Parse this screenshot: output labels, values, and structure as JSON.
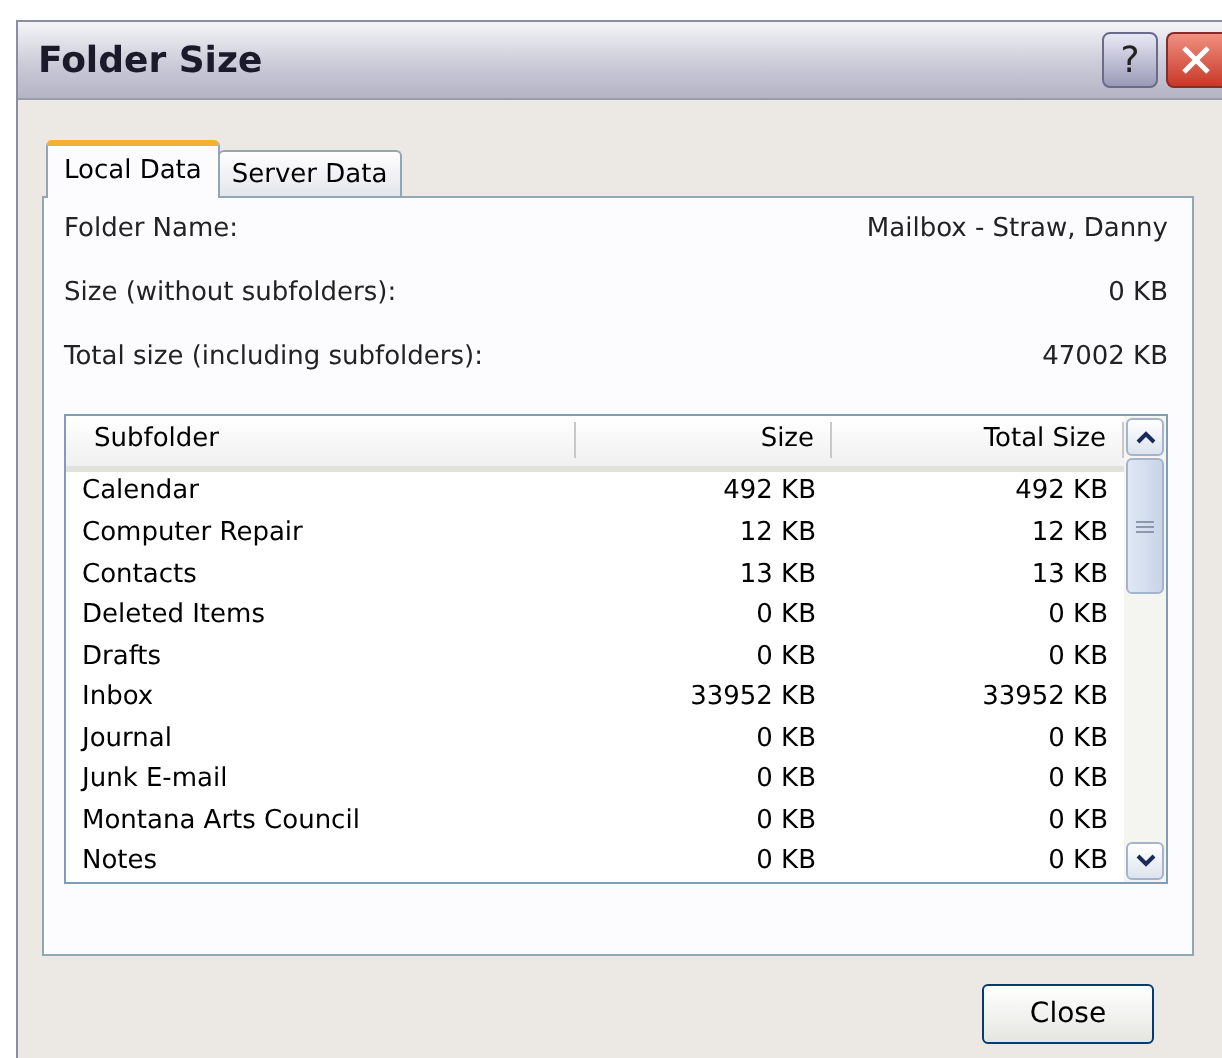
{
  "window": {
    "title": "Folder Size",
    "help_button": "?"
  },
  "tabs": [
    {
      "label": "Local Data",
      "selected": true
    },
    {
      "label": "Server Data",
      "selected": false
    }
  ],
  "info": [
    {
      "label": "Folder Name:",
      "value": "Mailbox - Straw, Danny"
    },
    {
      "label": "Size (without subfolders):",
      "value": "0 KB"
    },
    {
      "label": "Total size (including subfolders):",
      "value": "47002 KB"
    }
  ],
  "table": {
    "columns": [
      "Subfolder",
      "Size",
      "Total Size"
    ],
    "rows": [
      [
        "Calendar",
        "492 KB",
        "492 KB"
      ],
      [
        "Computer Repair",
        "12 KB",
        "12 KB"
      ],
      [
        "Contacts",
        "13 KB",
        "13 KB"
      ],
      [
        "Deleted Items",
        "0 KB",
        "0 KB"
      ],
      [
        "Drafts",
        "0 KB",
        "0 KB"
      ],
      [
        "Inbox",
        "33952 KB",
        "33952 KB"
      ],
      [
        "Journal",
        "0 KB",
        "0 KB"
      ],
      [
        "Junk E-mail",
        "0 KB",
        "0 KB"
      ],
      [
        "Montana Arts Council",
        "0 KB",
        "0 KB"
      ],
      [
        "Notes",
        "0 KB",
        "0 KB"
      ]
    ]
  },
  "buttons": [
    "Close"
  ]
}
